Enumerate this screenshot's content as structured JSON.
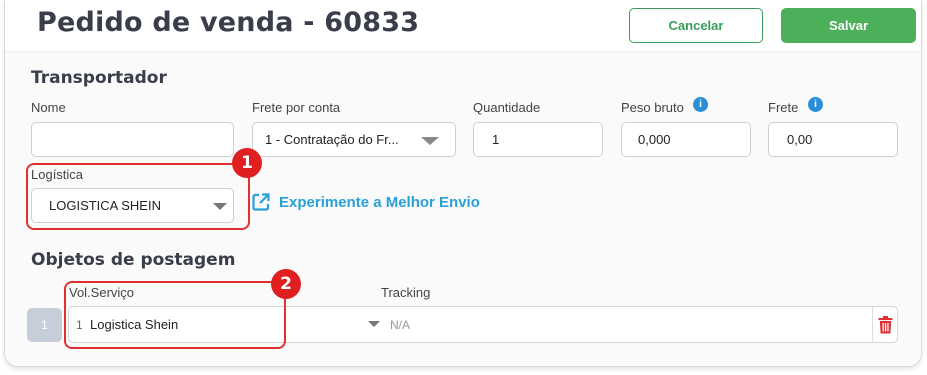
{
  "header": {
    "title": "Pedido de venda - 60833",
    "cancel_label": "Cancelar",
    "save_label": "Salvar"
  },
  "transportador": {
    "section_title": "Transportador",
    "nome": {
      "label": "Nome",
      "value": ""
    },
    "frete_por_conta": {
      "label": "Frete por conta",
      "value": "1 - Contratação do Fr..."
    },
    "quantidade": {
      "label": "Quantidade",
      "value": "1"
    },
    "peso_bruto": {
      "label": "Peso bruto",
      "value": "0,000"
    },
    "frete": {
      "label": "Frete",
      "value": "0,00"
    },
    "logistica": {
      "label": "Logística",
      "value": "LOGISTICA SHEIN"
    },
    "melhor_envio_link": "Experimente a Melhor Envio"
  },
  "objetos": {
    "section_title": "Objetos de postagem",
    "vol_servico_label": "Vol.Serviço",
    "tracking_label": "Tracking",
    "rows": [
      {
        "index": "1",
        "vol": "1",
        "servico": "Logistica Shein",
        "tracking": "N/A"
      }
    ]
  },
  "annotations": {
    "badge1": "1",
    "badge2": "2"
  },
  "colors": {
    "accent_green": "#4caf5a",
    "link_blue": "#2aa0d8",
    "annotation_red": "#e02020",
    "info_blue": "#2a8fd6"
  },
  "icons": {
    "info": "info-icon",
    "external_link": "external-link-icon",
    "trash": "trash-icon",
    "caret": "caret-down-icon"
  }
}
